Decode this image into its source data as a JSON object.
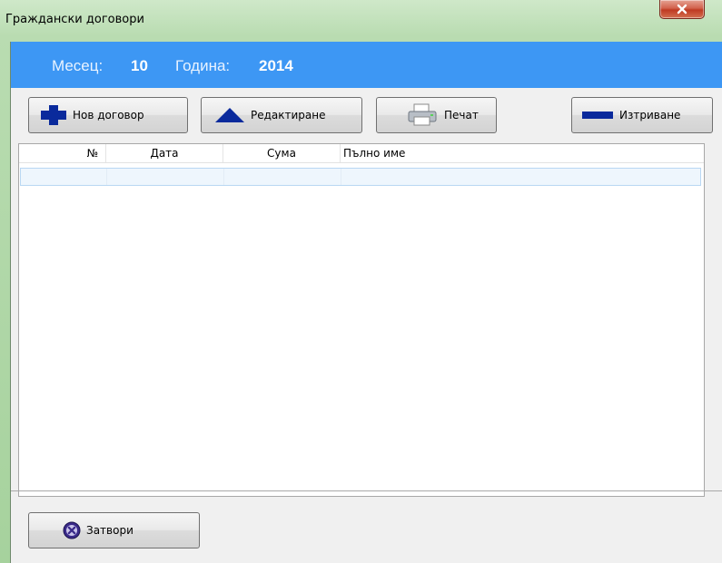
{
  "window": {
    "title": "Граждански договори"
  },
  "period": {
    "month_label": "Месец:",
    "month_value": "10",
    "year_label": "Година:",
    "year_value": "2014"
  },
  "toolbar": {
    "new_label": "Нов договор",
    "edit_label": "Редактиране",
    "print_label": "Печат",
    "delete_label": "Изтриване"
  },
  "grid": {
    "columns": [
      "№",
      "Дата",
      "Сума",
      "Пълно име"
    ],
    "rows": []
  },
  "footer": {
    "close_label": "Затвори"
  },
  "colors": {
    "header_band": "#3d97f4",
    "accent_icon": "#0a2a9c"
  }
}
